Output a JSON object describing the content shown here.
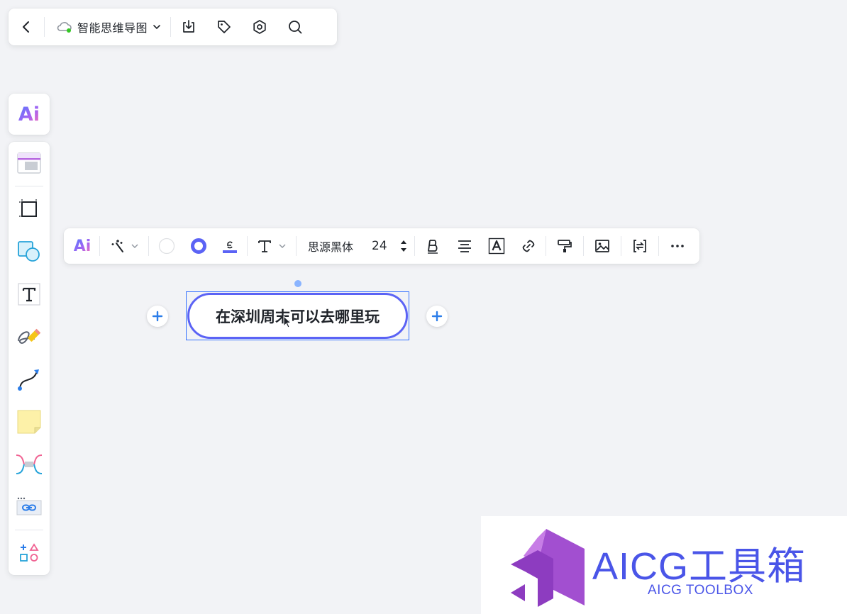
{
  "topbar": {
    "back_icon": "chevron-left-icon",
    "doc_title": "智能思维导图",
    "cloud_status_icon": "cloud-synced-icon",
    "dropdown_icon": "chevron-down-icon",
    "actions": [
      "download-icon",
      "tag-icon",
      "settings-icon",
      "search-icon"
    ]
  },
  "left_toolbar": {
    "ai_label": "Ai",
    "tools": [
      "template-icon",
      "frame-icon",
      "shape-icon",
      "text-tool-icon",
      "pen-icon",
      "connector-icon",
      "sticky-note-icon",
      "mindmap-icon",
      "link-card-icon",
      "more-tools-icon"
    ]
  },
  "format_toolbar": {
    "ai_label": "Ai",
    "font_name": "思源黑体",
    "font_size": "24",
    "colors": {
      "fill": "#ffffff",
      "border": "#5b63f5",
      "text_underline": "#5b63f5"
    }
  },
  "canvas": {
    "node_text": "在深圳周末可以去哪里玩"
  },
  "watermark": {
    "title": "AICG工具箱",
    "subtitle": "AICG TOOLBOX"
  },
  "colors": {
    "accent": "#5b63f5",
    "selection": "#3370ff",
    "plus": "#2b7de9",
    "brand_purple": "#a24fd0",
    "brand_blue": "#4a55e8"
  }
}
